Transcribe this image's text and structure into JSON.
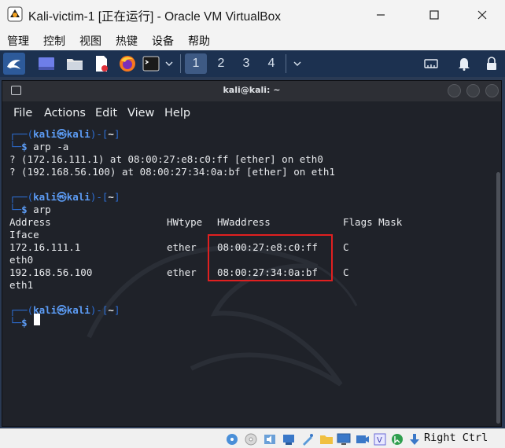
{
  "window": {
    "title": "Kali-victim-1 [正在运行] - Oracle VM VirtualBox",
    "minimize_icon": "minimize-icon",
    "maximize_icon": "maximize-icon",
    "close_icon": "close-icon"
  },
  "menubar": {
    "items": [
      "管理",
      "控制",
      "视图",
      "热键",
      "设备",
      "帮助"
    ]
  },
  "toolbar": {
    "workspaces": [
      "1",
      "2",
      "3",
      "4"
    ],
    "icons": [
      "kali-menu-icon",
      "desktop-icon",
      "file-manager-icon",
      "text-editor-icon",
      "firefox-icon",
      "terminal-icon",
      "chevron-down-icon",
      "chevron-down-icon",
      "network-icon",
      "bell-icon",
      "lock-icon"
    ]
  },
  "terminal": {
    "title": "kali@kali: ~",
    "menu": [
      "File",
      "Actions",
      "Edit",
      "View",
      "Help"
    ],
    "prompt_user": "kali㉿kali",
    "prompt_path": "~",
    "lines": {
      "cmd1": "arp -a",
      "out1": "? (172.16.111.1) at 08:00:27:e8:c0:ff [ether] on eth0",
      "out2": "? (192.168.56.100) at 08:00:27:34:0a:bf [ether] on eth1",
      "cmd2": "arp"
    },
    "arp_table": {
      "headers": [
        "Address",
        "HWtype",
        "HWaddress",
        "Flags Mask",
        "Iface"
      ],
      "rows": [
        {
          "address": "172.16.111.1",
          "hwtype": "ether",
          "hwaddress": "08:00:27:e8:c0:ff",
          "flags": "C",
          "iface": "eth0"
        },
        {
          "address": "192.168.56.100",
          "hwtype": "ether",
          "hwaddress": "08:00:27:34:0a:bf",
          "flags": "C",
          "iface": "eth1"
        }
      ]
    }
  },
  "statusbar": {
    "host_key": "Right Ctrl",
    "icons": [
      "hdd-icon",
      "optical-drive-icon",
      "audio-icon",
      "network-icon",
      "usb-icon",
      "shared-folders-icon",
      "display-icon",
      "recording-icon",
      "vt-x-icon",
      "mouse-integration-icon",
      "keyboard-capture-icon"
    ]
  },
  "colors": {
    "vbox_toolbar": "#1c3150",
    "terminal_bg": "#1f2229",
    "prompt_blue": "#5c9cf5",
    "highlight_red": "#e02020"
  }
}
